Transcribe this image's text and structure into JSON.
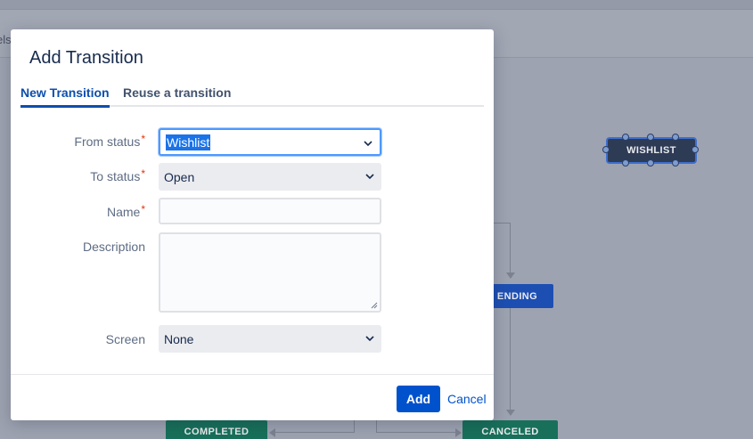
{
  "background": {
    "subbar_text": "els",
    "nodes": {
      "wishlist": "WISHLIST",
      "pending": "ENDING",
      "completed": "COMPLETED",
      "canceled": "CANCELED"
    }
  },
  "modal": {
    "title": "Add Transition",
    "tabs": [
      {
        "label": "New Transition",
        "active": true
      },
      {
        "label": "Reuse a transition",
        "active": false
      }
    ],
    "fields": {
      "from_status": {
        "label": "From status",
        "value": "Wishlist",
        "required_mark": "*"
      },
      "to_status": {
        "label": "To status",
        "value": "Open",
        "required_mark": "*"
      },
      "name": {
        "label": "Name",
        "value": "",
        "required_mark": "*"
      },
      "description": {
        "label": "Description",
        "value": ""
      },
      "screen": {
        "label": "Screen",
        "value": "None"
      }
    },
    "buttons": {
      "add": "Add",
      "cancel": "Cancel"
    }
  },
  "colors": {
    "primary": "#0052cc",
    "tab_active": "#0c4ead",
    "required": "#de350b",
    "status_done": "#18705a",
    "status_inprogress": "#1d4fb3"
  }
}
